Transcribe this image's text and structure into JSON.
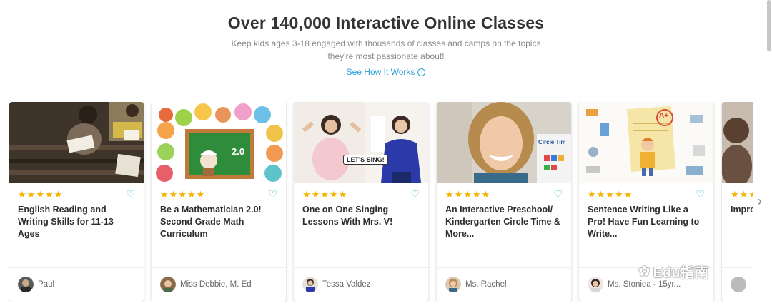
{
  "hero": {
    "title": "Over 140,000 Interactive Online Classes",
    "subtitle": "Keep kids ages 3-18 engaged with thousands of classes and camps on the topics they're most passionate about!",
    "link_label": "See How It Works",
    "link_icon": "arrow-down-circle-icon"
  },
  "cards": [
    {
      "title": "English Reading and Writing Skills for 11-13 Ages",
      "teacher": "Paul",
      "rating": 5
    },
    {
      "title": "Be a Mathematician 2.0! Second Grade Math Curriculum",
      "teacher": "Miss Debbie, M. Ed",
      "rating": 5
    },
    {
      "title": "One on One Singing Lessons With Mrs. V!",
      "teacher": "Tessa Valdez",
      "rating": 5,
      "image_caption": "LET'S SING!"
    },
    {
      "title": "An Interactive Preschool/ Kindergarten Circle Time & More...",
      "teacher": "Ms. Rachel",
      "rating": 5,
      "image_caption": "Circle Tim"
    },
    {
      "title": "Sentence Writing Like a Pro! Have Fun Learning to Write...",
      "teacher": "Ms. Stoniea - 15yr...",
      "rating": 4.5
    },
    {
      "title": "Impro With Train",
      "teacher": "",
      "rating": 3
    }
  ],
  "math_board_text": "2.0",
  "grade_badge": "A+",
  "watermark": "Edu指南",
  "colors": {
    "accent": "#2a9fd8",
    "star": "#f5b400",
    "heart": "#49b4e0"
  }
}
